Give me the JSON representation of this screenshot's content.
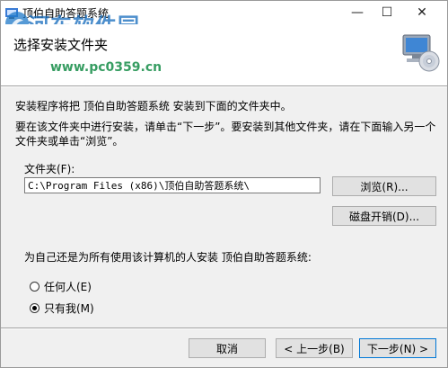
{
  "titlebar": {
    "title": "顶伯自助答题系统",
    "watermark": "河东软件园",
    "watermark_url": "www.pc0359.cn",
    "minimize_glyph": "—",
    "maximize_glyph": "☐",
    "close_glyph": "✕"
  },
  "header": {
    "title": "选择安装文件夹"
  },
  "body": {
    "line1": "安装程序将把 顶伯自助答题系统 安装到下面的文件夹中。",
    "line2": "要在该文件夹中进行安装，请单击“下一步”。要安装到其他文件夹，请在下面输入另一个文件夹或单击“浏览”。",
    "folder_label": "文件夹(F):",
    "folder_value": "C:\\Program Files (x86)\\顶伯自助答题系统\\",
    "browse_label": "浏览(R)...",
    "disk_cost_label": "磁盘开销(D)...",
    "install_for_label": "为自己还是为所有使用该计算机的人安装 顶伯自助答题系统:",
    "radio_everyone": "任何人(E)",
    "radio_just_me": "只有我(M)",
    "selected_option": "just_me"
  },
  "footer": {
    "cancel_label": "取消",
    "back_label": "< 上一步(B)",
    "next_label": "下一步(N) >"
  },
  "colors": {
    "window_bg": "#f0f0f0",
    "header_bg": "#ffffff",
    "watermark_blue": "#196ebe",
    "watermark_green": "#148c46",
    "default_button_border": "#0078d7"
  }
}
